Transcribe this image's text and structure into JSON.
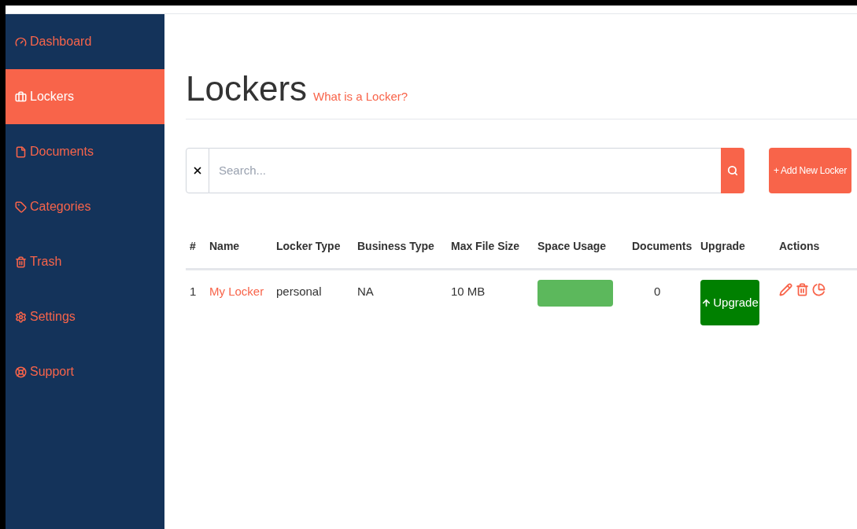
{
  "sidebar": {
    "items": [
      {
        "label": "Dashboard",
        "selected": false
      },
      {
        "label": "Lockers",
        "selected": true
      },
      {
        "label": "Documents",
        "selected": false
      },
      {
        "label": "Categories",
        "selected": false
      },
      {
        "label": "Trash",
        "selected": false
      },
      {
        "label": "Settings",
        "selected": false
      },
      {
        "label": "Support",
        "selected": false
      }
    ]
  },
  "page": {
    "title": "Lockers",
    "help_link": "What is a Locker?"
  },
  "search": {
    "placeholder": "Search..."
  },
  "add_button": "+ Add New Locker",
  "table": {
    "columns": [
      "#",
      "Name",
      "Locker Type",
      "Business Type",
      "Max File Size",
      "Space Usage",
      "Documents",
      "Upgrade",
      "Actions"
    ],
    "rows": [
      {
        "index": "1",
        "name": "My Locker",
        "locker_type": "personal",
        "business_type": "NA",
        "max_file_size": "10 MB",
        "space_usage": {
          "level": 1
        },
        "documents": "0",
        "upgrade": "Upgrade"
      }
    ]
  }
}
